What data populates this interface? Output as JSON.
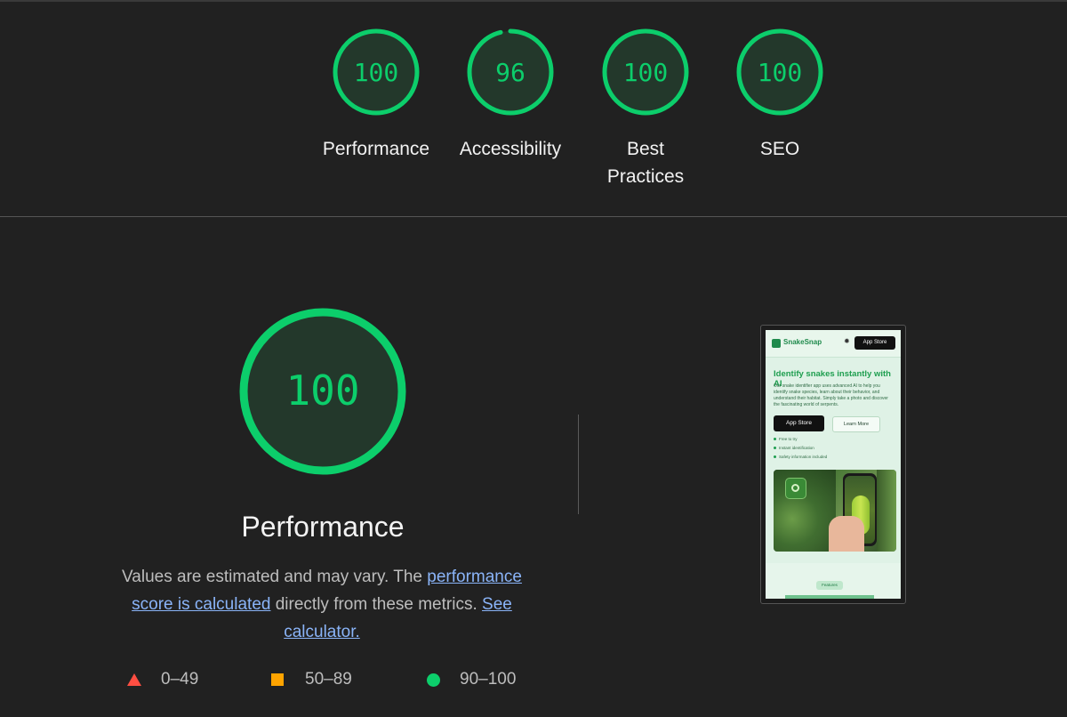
{
  "summary": {
    "categories": [
      {
        "label": "Performance",
        "score": "100",
        "fraction": 1.0
      },
      {
        "label": "Accessibility",
        "score": "96",
        "fraction": 0.96
      },
      {
        "label": "Best Practices",
        "score": "100",
        "fraction": 1.0
      },
      {
        "label": "SEO",
        "score": "100",
        "fraction": 1.0
      }
    ]
  },
  "main": {
    "score": "100",
    "fraction": 1.0,
    "title": "Performance",
    "desc": {
      "part1": "Values are estimated and may vary. The ",
      "link1": "performance score is calculated",
      "part2": " directly from these metrics. ",
      "link2": "See calculator."
    }
  },
  "legend": {
    "fail": "0–49",
    "average": "50–89",
    "pass": "90–100"
  },
  "thumbnail": {
    "brand": "SnakeSnap",
    "store_small": "App Store",
    "heading": "Identify snakes instantly with AI",
    "body": "Our snake identifier app uses advanced AI to help you identify snake species, learn about their behavior, and understand their habitat. Simply take a photo and discover the fascinating world of serpents.",
    "store_button": "App Store",
    "learn_button": "Learn More",
    "features": [
      "Free to try",
      "Instant identification",
      "Safety information included"
    ],
    "badge": "Features"
  },
  "colors": {
    "pass": "#0cce6b",
    "average": "#ffa400",
    "fail": "#ff4e42",
    "background": "#212121",
    "link": "#8ab4f8"
  }
}
